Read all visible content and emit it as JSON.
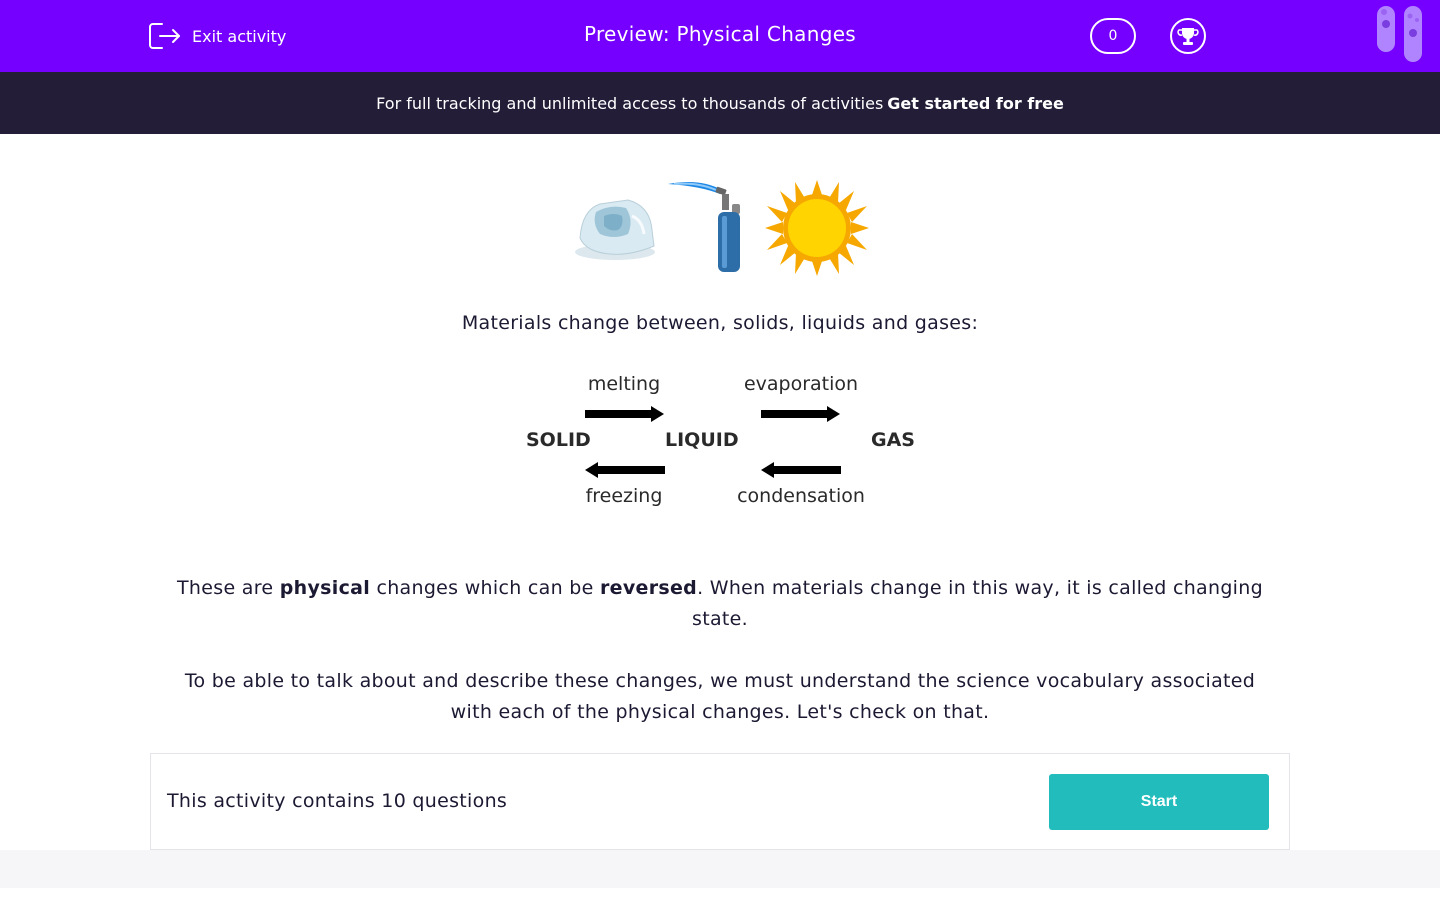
{
  "header": {
    "exit_label": "Exit activity",
    "title": "Preview: Physical Changes",
    "score": "0"
  },
  "banner": {
    "text": "For full tracking and unlimited access to thousands of activities",
    "cta": "Get started for free"
  },
  "content": {
    "intro": "Materials change between, solids, liquids and gases:",
    "diagram": {
      "states": [
        "SOLID",
        "LIQUID",
        "GAS"
      ],
      "top_labels": [
        "melting",
        "evaporation"
      ],
      "bottom_labels": [
        "freezing",
        "condensation"
      ]
    },
    "para1": {
      "p1": "These are ",
      "b1": "physical",
      "p2": " changes which can be ",
      "b2": "reversed",
      "p3": ". When materials change in this way, it is called changing state."
    },
    "para2": "To be able to talk about and describe these changes, we must understand the science vocabulary associated with each of the physical changes.  Let's check on that."
  },
  "footer": {
    "question_count_text": "This activity contains 10 questions",
    "start_label": "Start"
  },
  "colors": {
    "header_bg": "#7600ff",
    "banner_bg": "#231d38",
    "start_button": "#22bcbc"
  },
  "icons": [
    "exit-icon",
    "trophy-icon",
    "test-tubes-icon",
    "ice-cube-icon",
    "blowtorch-icon",
    "sun-icon"
  ]
}
